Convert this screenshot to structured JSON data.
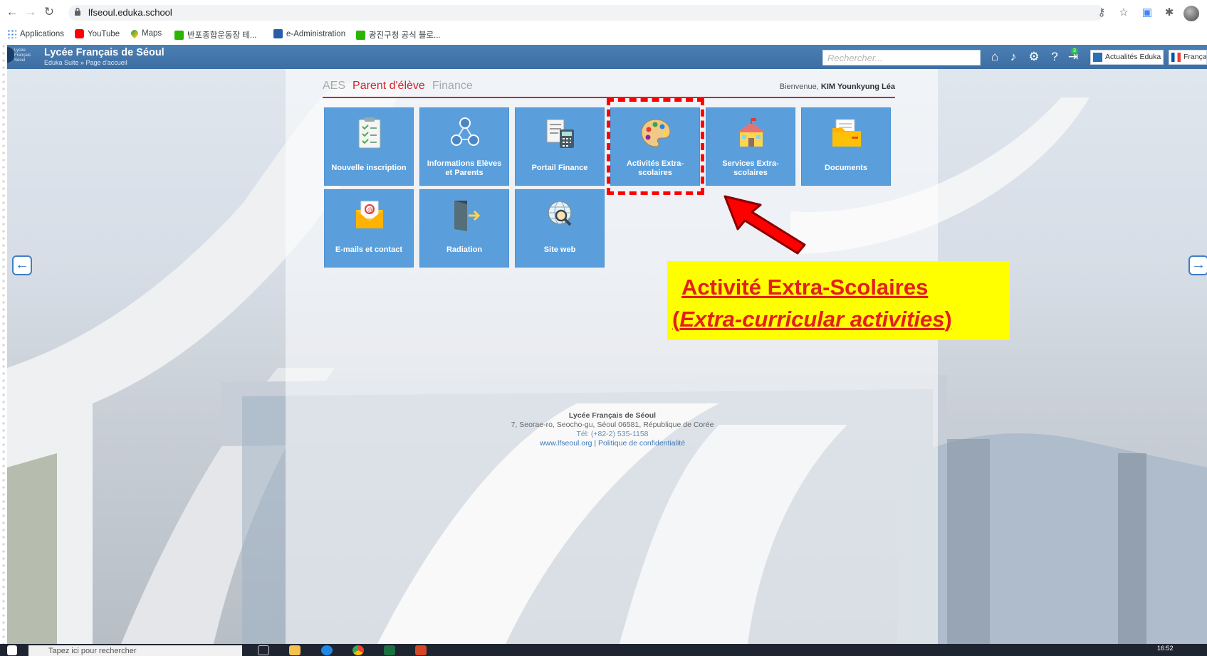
{
  "browser": {
    "url": "lfseoul.eduka.school",
    "bookmarks": [
      "Applications",
      "YouTube",
      "Maps",
      "반포종합운동장 테...",
      "e-Administration",
      "광진구청 공식 블로..."
    ]
  },
  "app": {
    "title": "Lycée Français de Séoul",
    "breadcrumb": "Eduka Suite » Page d'accueil",
    "logo_text": "Lycée Français Séoul",
    "search_placeholder": "Rechercher...",
    "notification_count": "3",
    "news_button": "Actualités Eduka",
    "language_button": "Français"
  },
  "tabs": [
    {
      "label": "AES",
      "active": false
    },
    {
      "label": "Parent d'élève",
      "active": true
    },
    {
      "label": "Finance",
      "active": false
    }
  ],
  "welcome": {
    "prefix": "Bienvenue,",
    "user": "KIM Younkyung Léa"
  },
  "tiles": [
    {
      "label": "Nouvelle inscription",
      "icon": "clipboard-checklist-icon"
    },
    {
      "label": "Informations Elèves et Parents",
      "icon": "people-network-icon"
    },
    {
      "label": "Portail Finance",
      "icon": "calculator-documents-icon"
    },
    {
      "label": "Activités Extra-scolaires",
      "icon": "paint-palette-icon"
    },
    {
      "label": "Services Extra-scolaires",
      "icon": "school-building-icon"
    },
    {
      "label": "Documents",
      "icon": "folder-documents-icon"
    },
    {
      "label": "E-mails et contact",
      "icon": "email-envelope-icon"
    },
    {
      "label": "Radiation",
      "icon": "exit-door-icon"
    },
    {
      "label": "Site web",
      "icon": "globe-magnifier-icon"
    }
  ],
  "annotation": {
    "line1": "Activité Extra-Scolaires",
    "line2_open": "(",
    "line2_italic": "Extra-curricular activities",
    "line2_close": ")",
    "highlight_color": "#ff0000",
    "callout_bg": "#ffff00"
  },
  "footer": {
    "name": "Lycée Français de Séoul",
    "address": "7, Seorae-ro, Seocho-gu, Séoul 06581, République de Corée",
    "tel": "Tél: (+82-2) 535-1158",
    "website": "www.lfseoul.org",
    "separator": " | ",
    "privacy": "Politique de confidentialité"
  },
  "taskbar": {
    "search_placeholder": "Tapez ici pour rechercher",
    "time": "16:52"
  },
  "colors": {
    "header_blue": "#4b7fb4",
    "tile_blue": "#5a9fdc",
    "tab_red": "#d2232a"
  }
}
